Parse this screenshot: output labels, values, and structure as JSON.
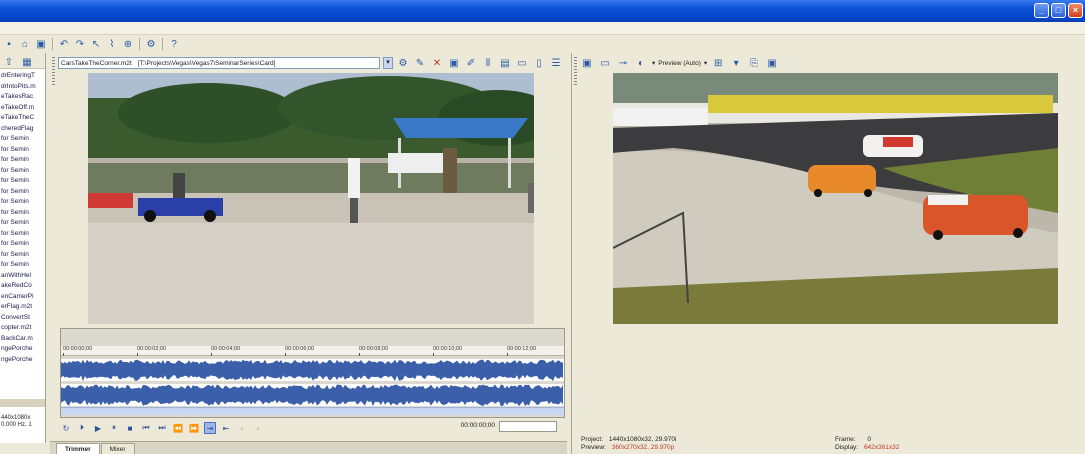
{
  "window": {
    "caps": [
      "_",
      "□",
      "×"
    ]
  },
  "main_toolbar": {
    "icons": [
      "new-icon",
      "open-icon",
      "save-icon",
      "cut-icon",
      "copy-icon",
      "paste-icon",
      "undo-icon",
      "redo-icon",
      "normal-tool-icon",
      "envelope-icon",
      "zoom-icon",
      "properties-icon",
      "whats-this-icon"
    ]
  },
  "explorer": {
    "items": [
      "drEnteringT",
      "drIntoPits.m",
      "eTakesRac",
      "eTakeOff.m",
      "eTakeTheC",
      "cheredFlag",
      "for Semin",
      "for Semin",
      "for Semin",
      "for Semin",
      "for Semin",
      "for Semin",
      "for Semin",
      "for Semin",
      "for Semin",
      "for Semin",
      "for Semin",
      "for Semin",
      "for Semin",
      "anWithHel",
      "akeRedCo",
      "enCamerPi",
      "erFlag.m2t",
      "ConvertSt",
      "copter.m2t",
      "BackCar.m",
      "ngePorche",
      "ngePorche"
    ],
    "info_line1": "440x1080x",
    "info_line2": "0.000 Hz, 1"
  },
  "trimmer": {
    "file_name": "CarsTakeTheCorner.m2t",
    "file_path": "[T:\\Projects\\Vegas\\Vegas7\\SeminarSeries\\Card]",
    "ruler_ticks": [
      "00:00:00;00",
      "00:00:02;00",
      "00:00:04;00",
      "00:00:06;00",
      "00:00:08;00",
      "00:00:10;00",
      "00:00:12;00"
    ],
    "timecode": "00:00:00;00",
    "tabs": [
      "Trimmer",
      "Mixer"
    ]
  },
  "preview": {
    "quality_label": "Preview (Auto)",
    "project_label": "Project:",
    "project_value": "1440x1080x32, 29.970i",
    "preview_label": "Preview:",
    "preview_value": "360x270x32, 29.970p",
    "frame_label": "Frame:",
    "frame_value": "0",
    "display_label": "Display:",
    "display_value": "642x361x32"
  },
  "colors": {
    "titlebar": "#0a4fd6",
    "waveform": "#3b5fa8",
    "accent_red": "#c0392b"
  }
}
